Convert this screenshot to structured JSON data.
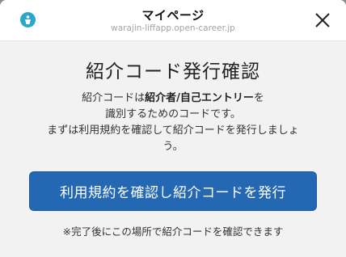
{
  "header": {
    "title": "マイページ",
    "url": "warajin-liffapp.open-career.jp",
    "icon": "app-logo-icon",
    "close_icon": "close-icon"
  },
  "main": {
    "title": "紹介コード発行確認",
    "desc_line1_pre": "紹介コードは",
    "desc_line1_bold": "紹介者/自己エントリー",
    "desc_line1_post": "を",
    "desc_line2": "識別するためのコードです。",
    "desc_line3": "まずは利用規約を確認して紹介コードを発行しましょ",
    "desc_line4": "う。",
    "button_label": "利用規約を確認し紹介コードを発行",
    "note": "※完了後にこの場所で紹介コードを確認できます"
  },
  "colors": {
    "accent": "#2468b4",
    "icon_bg": "#2aa7c9"
  }
}
